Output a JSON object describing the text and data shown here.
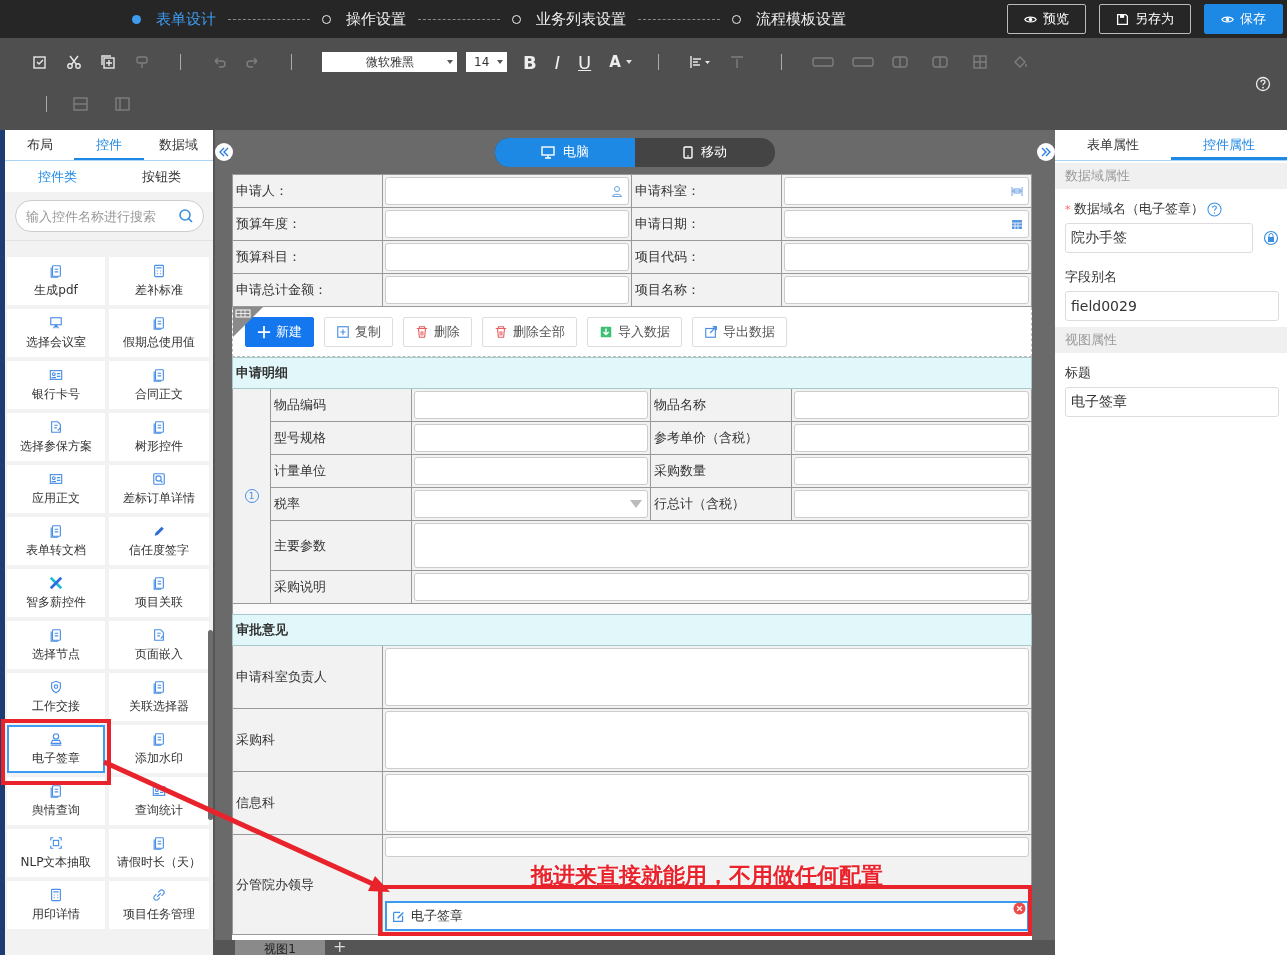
{
  "steps": [
    {
      "label": "表单设计",
      "selected": true
    },
    {
      "label": "操作设置",
      "selected": false
    },
    {
      "label": "业务列表设置",
      "selected": false
    },
    {
      "label": "流程模板设置",
      "selected": false
    }
  ],
  "header_buttons": [
    {
      "label": "预览",
      "kind": "default"
    },
    {
      "label": "另存为",
      "kind": "default"
    },
    {
      "label": "保存",
      "kind": "primary"
    }
  ],
  "toolbar": {
    "font": "微软雅黑",
    "size": "14",
    "format": [
      {
        "label": "B",
        "kind": "bold"
      },
      {
        "label": "I",
        "kind": "italic"
      },
      {
        "label": "U",
        "kind": "underline"
      },
      {
        "label": "A",
        "kind": "color"
      }
    ]
  },
  "left_panel": {
    "tabs": [
      {
        "label": "布局",
        "selected": false
      },
      {
        "label": "控件",
        "selected": true
      },
      {
        "label": "数据域",
        "selected": false
      }
    ],
    "subtabs": [
      {
        "label": "控件类",
        "selected": true
      },
      {
        "label": "按钮类",
        "selected": false
      }
    ],
    "search": {
      "placeholder": "输入控件名称进行搜索"
    },
    "controls": [
      {
        "label": "生成pdf",
        "selected": false
      },
      {
        "label": "差补标准",
        "selected": false
      },
      {
        "label": "选择会议室",
        "selected": false
      },
      {
        "label": "假期总使用值",
        "selected": false
      },
      {
        "label": "银行卡号",
        "selected": false
      },
      {
        "label": "合同正文",
        "selected": false
      },
      {
        "label": "选择参保方案",
        "selected": false
      },
      {
        "label": "树形控件",
        "selected": false
      },
      {
        "label": "应用正文",
        "selected": false
      },
      {
        "label": "差标订单详情",
        "selected": false
      },
      {
        "label": "表单转文档",
        "selected": false
      },
      {
        "label": "信任度签字",
        "selected": false
      },
      {
        "label": "智多薪控件",
        "selected": false
      },
      {
        "label": "项目关联",
        "selected": false
      },
      {
        "label": "选择节点",
        "selected": false
      },
      {
        "label": "页面嵌入",
        "selected": false
      },
      {
        "label": "工作交接",
        "selected": false
      },
      {
        "label": "关联选择器",
        "selected": false
      },
      {
        "label": "电子签章",
        "selected": true
      },
      {
        "label": "添加水印",
        "selected": false
      },
      {
        "label": "舆情查询",
        "selected": false
      },
      {
        "label": "查询统计",
        "selected": false
      },
      {
        "label": "NLP文本抽取",
        "selected": false
      },
      {
        "label": "请假时长（天）",
        "selected": false
      },
      {
        "label": "用印详情",
        "selected": false
      },
      {
        "label": "项目任务管理",
        "selected": false
      }
    ]
  },
  "views": [
    {
      "label": "电脑",
      "selected": true
    },
    {
      "label": "移动",
      "selected": false
    }
  ],
  "form": {
    "fields": [
      {
        "label": "申请人："
      },
      {
        "label": "申请科室："
      },
      {
        "label": "预算年度："
      },
      {
        "label": "申请日期："
      },
      {
        "label": "预算科目："
      },
      {
        "label": "项目代码："
      },
      {
        "label": "申请总计金额："
      },
      {
        "label": "项目名称："
      }
    ],
    "actions": [
      {
        "label": "新建",
        "kind": "primary"
      },
      {
        "label": "复制",
        "kind": "default"
      },
      {
        "label": "删除",
        "kind": "default"
      },
      {
        "label": "删除全部",
        "kind": "default"
      },
      {
        "label": "导入数据",
        "kind": "default"
      },
      {
        "label": "导出数据",
        "kind": "default"
      }
    ],
    "details": {
      "title": "申请明细",
      "row_number": "1",
      "fields": [
        {
          "label": "物品编码",
          "kind": "text"
        },
        {
          "label": "物品名称",
          "kind": "text"
        },
        {
          "label": "型号规格",
          "kind": "text"
        },
        {
          "label": "参考单价（含税）",
          "kind": "text"
        },
        {
          "label": "计量单位",
          "kind": "text"
        },
        {
          "label": "采购数量",
          "kind": "text"
        },
        {
          "label": "税率",
          "kind": "select"
        },
        {
          "label": "行总计（含税）",
          "kind": "text"
        },
        {
          "label": "主要参数",
          "kind": "textarea"
        },
        {
          "label": "采购说明",
          "kind": "wide"
        }
      ]
    },
    "approval": {
      "title": "审批意见",
      "rows": [
        {
          "label": "申请科室负责人"
        },
        {
          "label": "采购科"
        },
        {
          "label": "信息科"
        },
        {
          "label": "分管院办领导",
          "control": {
            "label": "电子签章"
          }
        }
      ]
    }
  },
  "annotation": {
    "text": "拖进来直接就能用，不用做任何配置"
  },
  "view_tabs": [
    {
      "label": "视图1"
    }
  ],
  "add_view": "+",
  "properties": {
    "tabs": [
      {
        "label": "表单属性",
        "selected": false
      },
      {
        "label": "控件属性",
        "selected": true
      }
    ],
    "sections": [
      {
        "title": "数据域属性",
        "fields": [
          {
            "mark": "*",
            "label": "数据域名（电子签章）",
            "value": "院办手签",
            "kind": "bound"
          },
          {
            "label": "字段别名",
            "value": "field0029",
            "kind": "plain"
          }
        ]
      },
      {
        "title": "视图属性",
        "fields": [
          {
            "label": "标题",
            "value": "电子签章",
            "kind": "plain"
          }
        ]
      }
    ]
  }
}
